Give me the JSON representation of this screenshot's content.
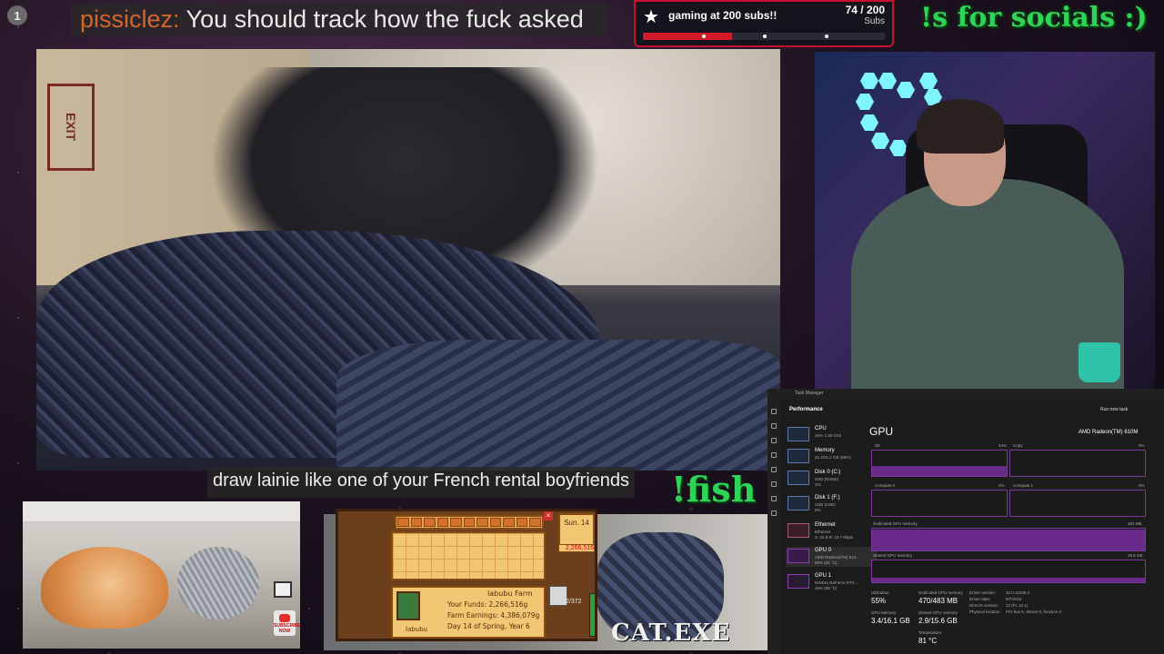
{
  "chat_top": {
    "badge": "1",
    "user": "pissiclez:",
    "message": "You should track how the fuck asked"
  },
  "sub_goal": {
    "title": "gaming at 200 subs!!",
    "count": "74 / 200",
    "unit": "Subs",
    "progress": 0.37,
    "accent": "#d11a2a"
  },
  "socials": "!s for socials :)",
  "main_cam": {
    "exit_sign": "EXIT"
  },
  "chat_bottom": "draw lainie like one of your French rental boyfriends",
  "fish": "!fish",
  "cat_panel": {
    "subscribe": "SUBSCRIBE NOW"
  },
  "catexe": "CAT.EXE",
  "stardew": {
    "farm": "labubu Farm",
    "funds": "Your Funds: 2,266,516g",
    "earnings": "Farm Earnings: 4,386,079g",
    "day": "Day 14 of Spring, Year 6",
    "player": "labubu",
    "clock": "Sun. 14",
    "gold": "2,266,516",
    "fraction": "2/372"
  },
  "task_manager": {
    "window_title": "Task Manager",
    "section": "Performance",
    "run_task": "Run new task",
    "sidebar": [
      {
        "name": "CPU",
        "d1": "26% 1.36 GHz",
        "d2": ""
      },
      {
        "name": "Memory",
        "d1": "21.4/31.2 GB (69%)",
        "d2": ""
      },
      {
        "name": "Disk 0 (C:)",
        "d1": "SSD (NVMe)",
        "d2": "1%"
      },
      {
        "name": "Disk 1 (F:)",
        "d1": "USB (USB)",
        "d2": "0%"
      },
      {
        "name": "Ethernet",
        "d1": "Ethernet",
        "d2": "S: 23.9  R: 10.7 Mbps"
      },
      {
        "name": "GPU 0",
        "d1": "AMD Radeon(TM) 610...",
        "d2": "55% (81 °C)"
      },
      {
        "name": "GPU 1",
        "d1": "NVIDIA GeForce RTX ...",
        "d2": "16% (68 °C)"
      }
    ],
    "gpu_title": "GPU",
    "gpu_name": "AMD Radeon(TM) 610M",
    "graphs": {
      "g3d": "3D",
      "g3d_pct": "44%",
      "copy": "Copy",
      "copy_pct": "0%",
      "compute0": "Compute 0",
      "compute0_pct": "0%",
      "compute1": "Compute 1",
      "compute1_pct": "0%",
      "dedicated": "Dedicated GPU memory",
      "dedicated_max": "483 MB",
      "shared": "Shared GPU memory",
      "shared_max": "15.6 GB"
    },
    "stats": {
      "util_l": "Utilization",
      "util_v": "55%",
      "ded_l": "Dedicated GPU memory",
      "ded_v": "470/483 MB",
      "gmem_l": "GPU Memory",
      "gmem_v": "3.4/16.1 GB",
      "shared_l": "Shared GPU memory",
      "shared_v": "2.9/15.6 GB",
      "temp_l": "Temperature",
      "temp_v": "81 °C"
    },
    "driver": {
      "ver_k": "Driver version:",
      "ver_v": "32.0.11036.4",
      "date_k": "Driver date:",
      "date_v": "8/7/2024",
      "dx_k": "DirectX version:",
      "dx_v": "12 (FL 12.1)",
      "loc_k": "Physical location:",
      "loc_v": "PCI bus 5, device 0, function 0"
    }
  }
}
